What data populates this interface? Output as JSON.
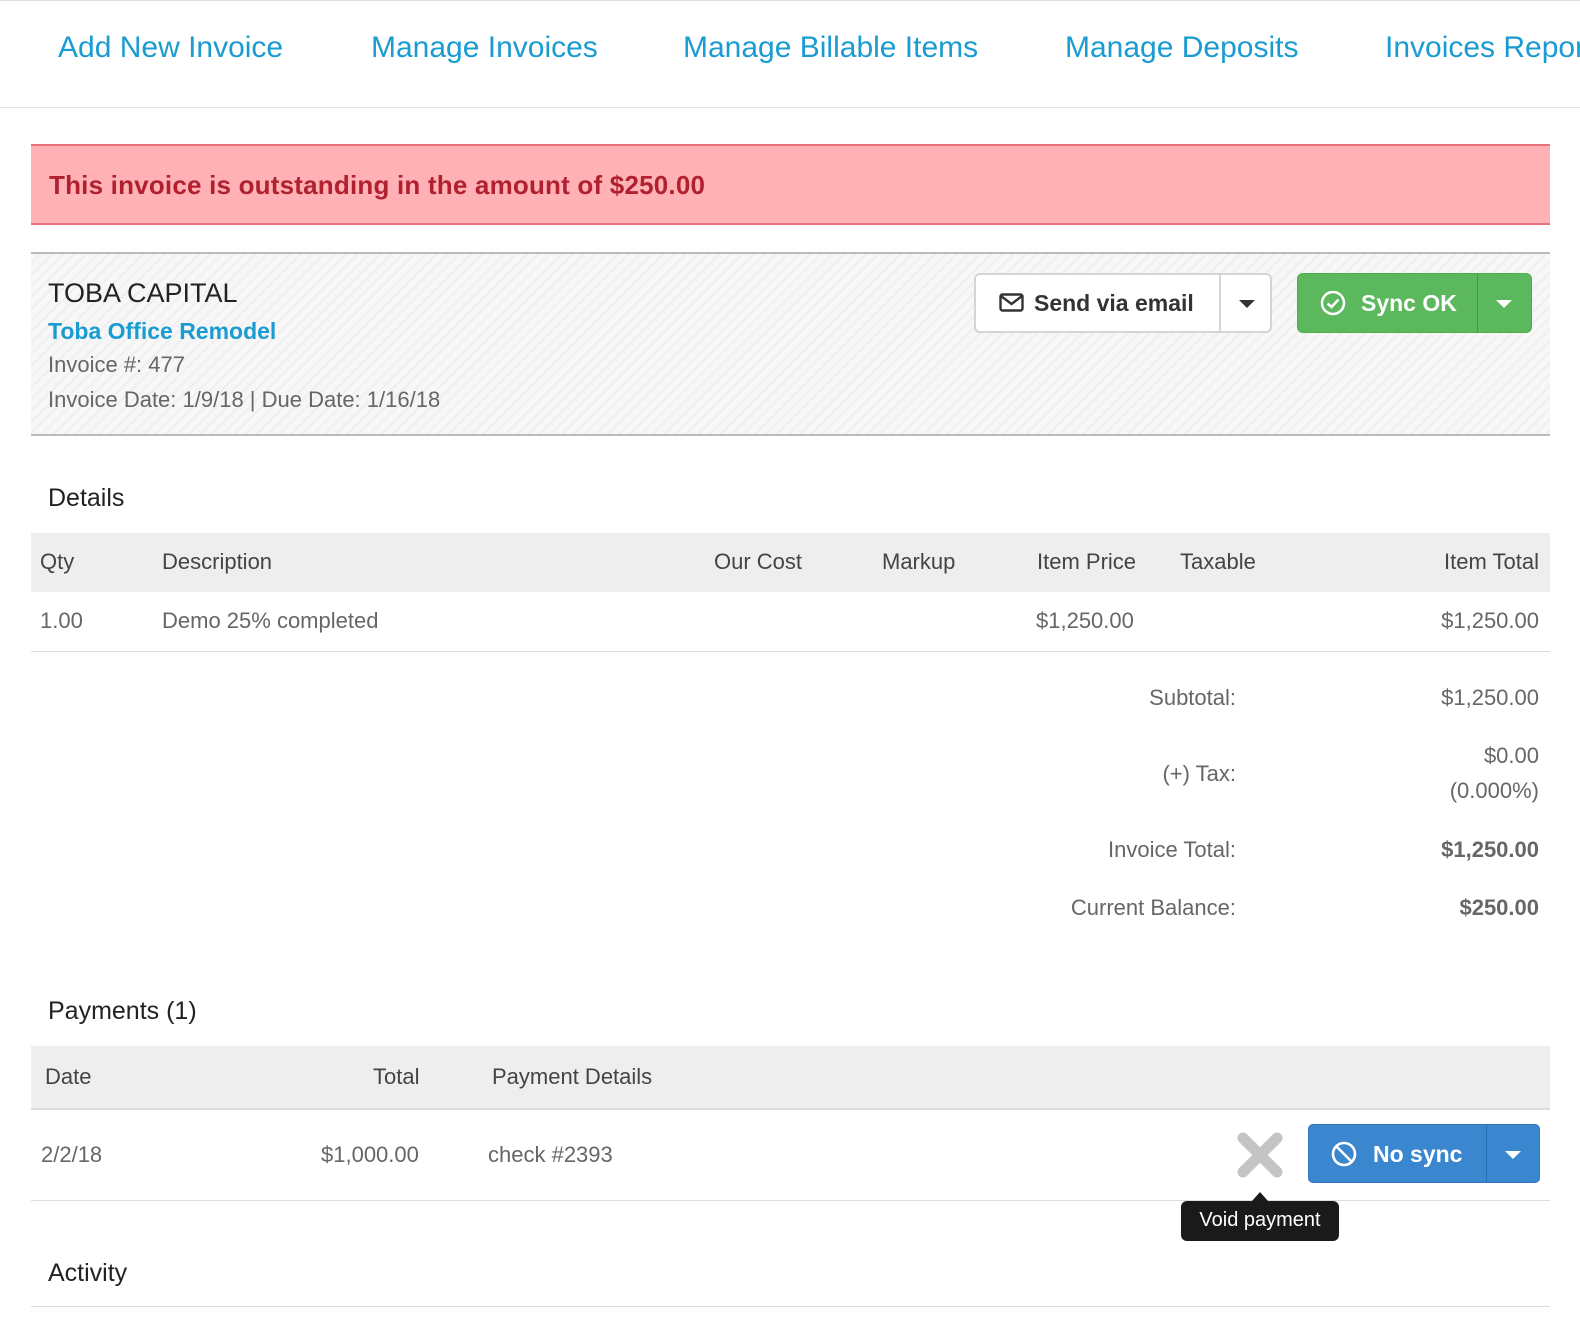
{
  "nav": {
    "items": [
      "Add New Invoice",
      "Manage Invoices",
      "Manage Billable Items",
      "Manage Deposits",
      "Invoices Reports"
    ]
  },
  "alert": {
    "text": "This invoice is outstanding in the amount of $250.00"
  },
  "invoice": {
    "client": "TOBA CAPITAL",
    "project": "Toba Office Remodel",
    "number_line": "Invoice #: 477",
    "dates_line": "Invoice Date: 1/9/18 | Due Date: 1/16/18"
  },
  "actions": {
    "send_email_label": "Send via email",
    "sync_label": "Sync OK",
    "sync_color": "#5cb85c"
  },
  "details": {
    "title": "Details",
    "columns": [
      "Qty",
      "Description",
      "Our Cost",
      "Markup",
      "Item Price",
      "Taxable",
      "Item Total"
    ],
    "rows": [
      {
        "qty": "1.00",
        "description": "Demo 25% completed",
        "our_cost": "",
        "markup": "",
        "item_price": "$1,250.00",
        "taxable": "",
        "item_total": "$1,250.00"
      }
    ]
  },
  "summary": {
    "subtotal_label": "Subtotal:",
    "subtotal": "$1,250.00",
    "tax_label": "(+) Tax:",
    "tax_amount": "$0.00",
    "tax_rate": "(0.000%)",
    "total_label": "Invoice Total:",
    "total": "$1,250.00",
    "balance_label": "Current Balance:",
    "balance": "$250.00"
  },
  "payments": {
    "title": "Payments (1)",
    "columns": [
      "Date",
      "Total",
      "Payment Details"
    ],
    "rows": [
      {
        "date": "2/2/18",
        "total": "$1,000.00",
        "details": "check #2393"
      }
    ],
    "nosync_label": "No sync",
    "nosync_color": "#3a86cf",
    "void_tooltip": "Void payment"
  },
  "activity": {
    "title": "Activity"
  },
  "colors": {
    "link": "#1a9bd1",
    "alert_bg": "#ffb1b6",
    "alert_text": "#b0212f"
  },
  "icons": [
    "envelope-icon",
    "chevron-down-icon",
    "check-circle-icon",
    "ban-icon",
    "close-icon"
  ]
}
